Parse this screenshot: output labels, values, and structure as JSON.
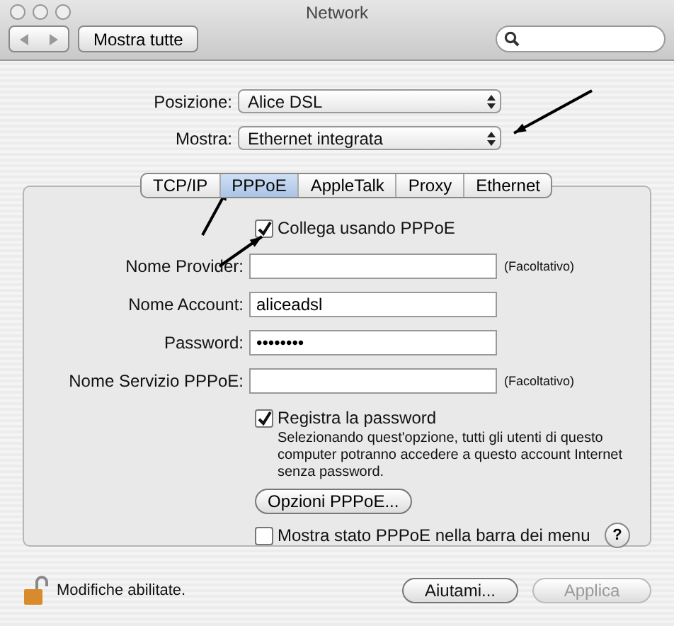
{
  "window": {
    "title": "Network"
  },
  "toolbar": {
    "show_all": "Mostra tutte"
  },
  "popups": [
    {
      "label": "Posizione:",
      "value": "Alice DSL"
    },
    {
      "label": "Mostra:",
      "value": "Ethernet integrata"
    }
  ],
  "tabs": [
    {
      "label": "TCP/IP",
      "selected": false
    },
    {
      "label": "PPPoE",
      "selected": true
    },
    {
      "label": "AppleTalk",
      "selected": false
    },
    {
      "label": "Proxy",
      "selected": false
    },
    {
      "label": "Ethernet",
      "selected": false
    }
  ],
  "connect_checkbox": {
    "label": "Collega usando PPPoE",
    "checked": true
  },
  "fields": [
    {
      "label": "Nome Provider:",
      "note": "(Facoltativo)"
    },
    {
      "label": "Nome Account:",
      "value": "aliceadsl"
    },
    {
      "label": "Password:",
      "value": "••••••••"
    },
    {
      "label": "Nome Servizio PPPoE:",
      "note": "(Facoltativo)"
    }
  ],
  "save_password": {
    "label": "Registra la password",
    "checked": true,
    "description": "Selezionando quest'opzione, tutti gli utenti di questo computer potranno accedere a questo account Internet senza password."
  },
  "options_button": "Opzioni PPPoE...",
  "menu_status_checkbox": {
    "label": "Mostra stato PPPoE nella barra dei menu",
    "checked": false
  },
  "help_button": "?",
  "lock": {
    "text": "Modifiche abilitate.",
    "locked": false
  },
  "buttons": [
    {
      "label": "Aiutami...",
      "disabled": false
    },
    {
      "label": "Applica",
      "disabled": true
    }
  ]
}
